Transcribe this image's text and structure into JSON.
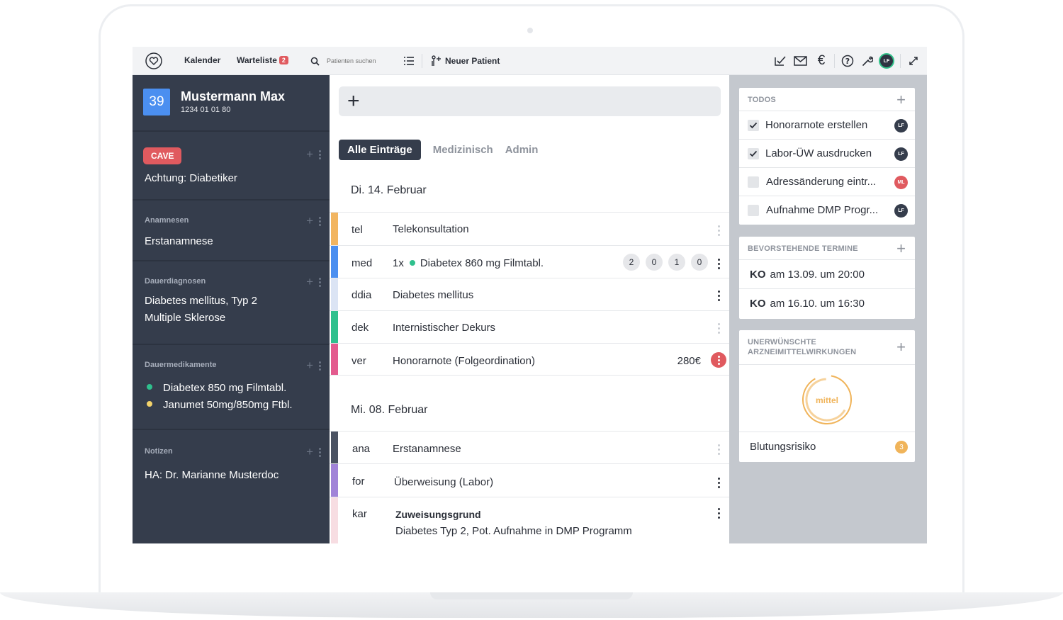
{
  "topbar": {
    "calendar": "Kalender",
    "waitlist": "Warteliste",
    "waitlist_count": "2",
    "search_placeholder": "Patienten suchen",
    "new_patient": "Neuer Patient",
    "avatar": "LF",
    "icons": [
      "heart-logo-icon",
      "search-icon",
      "list-icon",
      "add-person-icon",
      "check-icon",
      "mail-icon",
      "euro-icon",
      "help-icon",
      "wrench-icon",
      "expand-icon"
    ]
  },
  "patient": {
    "room": "39",
    "name": "Mustermann Max",
    "id": "1234 01 01 80"
  },
  "sidebar": {
    "cave_label": "CAVE",
    "cave_text": "Achtung: Diabetiker",
    "anamnesen_title": "Anamnesen",
    "anamnesen_text": "Erstanamnese",
    "diagnosen_title": "Dauerdiagnosen",
    "diagnosen": [
      "Diabetes mellitus, Typ 2",
      "Multiple Sklerose"
    ],
    "medikamente_title": "Dauermedikamente",
    "medikamente": [
      {
        "name": "Diabetex 850 mg Filmtabl.",
        "color": "#2fc08d"
      },
      {
        "name": "Janumet 50mg/850mg Ftbl.",
        "color": "#f3d36b"
      }
    ],
    "notizen_title": "Notizen",
    "notizen_text": "HA: Dr. Marianne Musterdoc"
  },
  "main": {
    "add_symbol": "+",
    "tabs": [
      "Alle Einträge",
      "Medizinisch",
      "Admin"
    ],
    "day1": "Di. 14. Februar",
    "day2": "Mi. 08. Februar",
    "entries1": [
      {
        "code": "tel",
        "text": "Telekonsultation",
        "color": "#f2b560"
      },
      {
        "code": "med",
        "qty": "1x",
        "text": "Diabetex 860 mg Filmtabl.",
        "color": "#4b8ff0",
        "dose": [
          "2",
          "0",
          "1",
          "0"
        ]
      },
      {
        "code": "ddia",
        "text": "Diabetes mellitus",
        "color": "#dbe4f4"
      },
      {
        "code": "dek",
        "text": "Internistischer Dekurs",
        "color": "#2fc08d"
      },
      {
        "code": "ver",
        "text": "Honorarnote (Folgeordination)",
        "price": "280€",
        "color": "#e35b8e"
      }
    ],
    "entries2": [
      {
        "code": "ana",
        "text": "Erstanamnese",
        "color": "#4a5262"
      },
      {
        "code": "for",
        "text": "Überweisung (Labor)",
        "color": "#a184d8"
      },
      {
        "code": "kar",
        "title": "Zuweisungsgrund",
        "text": "Diabetes Typ 2, Pot. Aufnahme in DMP Programm",
        "color": "#f7dde2"
      }
    ]
  },
  "right": {
    "todos_title": "TODOS",
    "todos": [
      {
        "label": "Honorarnote erstellen",
        "checked": true,
        "who": "LF",
        "who_color": "#353d4c"
      },
      {
        "label": "Labor-ÜW ausdrucken",
        "checked": true,
        "who": "LF",
        "who_color": "#353d4c"
      },
      {
        "label": "Adressänderung eintr...",
        "checked": false,
        "who": "ML",
        "who_color": "#e05a5f"
      },
      {
        "label": "Aufnahme DMP Progr...",
        "checked": false,
        "who": "LF",
        "who_color": "#353d4c"
      }
    ],
    "termine_title": "BEVORSTEHENDE TERMINE",
    "termine": [
      {
        "type": "KO",
        "text": "am 13.09. um 20:00"
      },
      {
        "type": "KO",
        "text": "am 16.10. um 16:30"
      }
    ],
    "uaw_title_1": "UNERWÜNSCHTE",
    "uaw_title_2": "ARZNEIMITTELWIRKUNGEN",
    "gauge_label": "mittel",
    "risk_label": "Blutungsrisiko",
    "risk_count": "3"
  }
}
